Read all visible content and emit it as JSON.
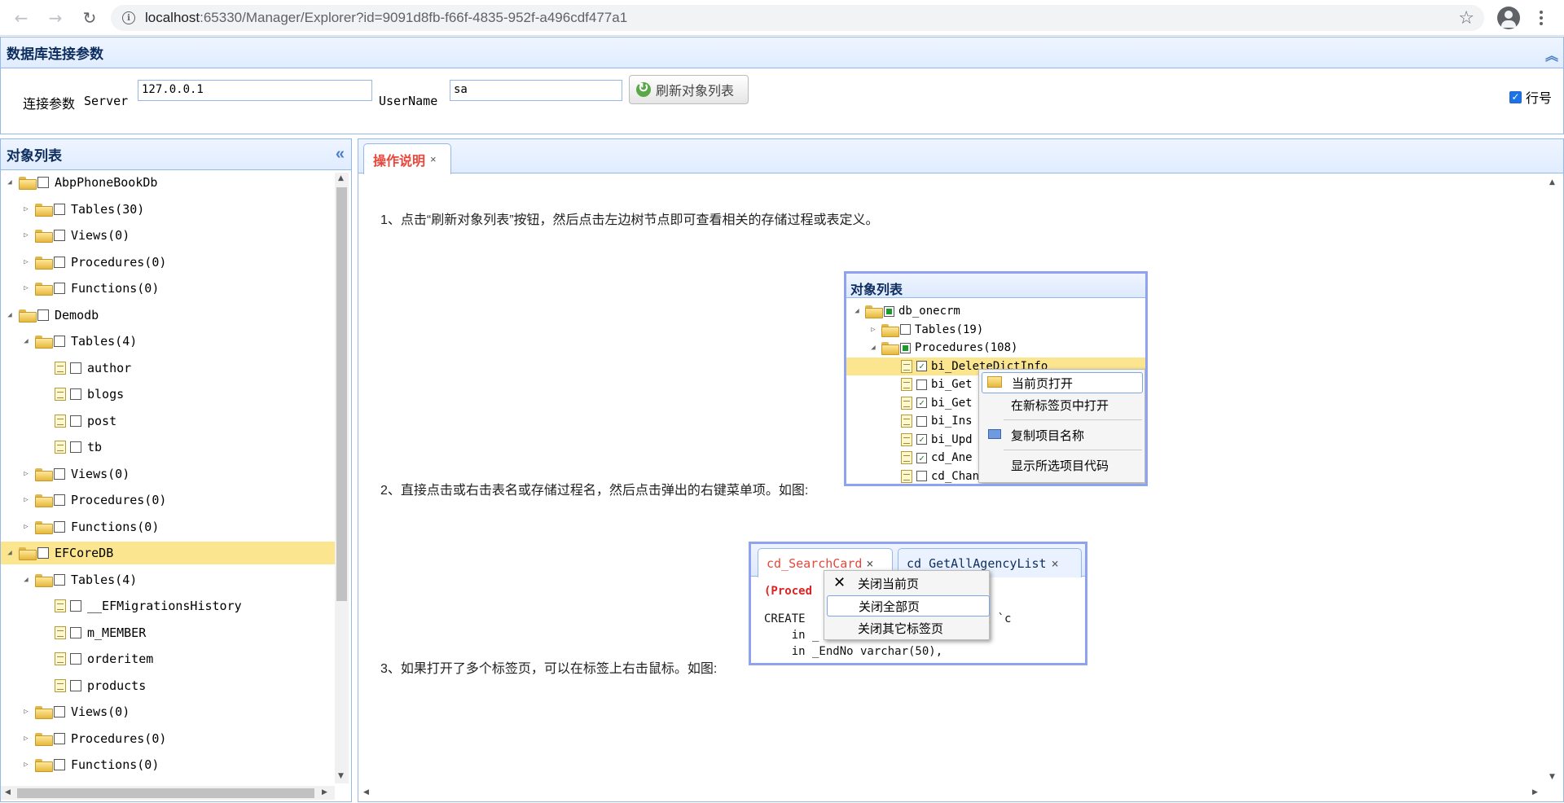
{
  "browser": {
    "url_host": "localhost",
    "url_rest": ":65330/Manager/Explorer?id=9091d8fb-f66f-4835-952f-a496cdf477a1"
  },
  "conn_panel": {
    "title": "数据库连接参数",
    "label": "连接参数",
    "server_label": "Server",
    "server_value": "127.0.0.1",
    "username_label": "UserName",
    "username_value": "sa",
    "refresh_label": "刷新对象列表",
    "linenum_label": "行号",
    "linenum_checked": true
  },
  "object_panel": {
    "title": "对象列表",
    "tree": [
      {
        "label": "AbpPhoneBookDb",
        "level": 0,
        "icon": "folder-icon",
        "toggle": "expanded"
      },
      {
        "label": "Tables(30)",
        "level": 1,
        "icon": "folder-icon",
        "toggle": "collapsed"
      },
      {
        "label": "Views(0)",
        "level": 1,
        "icon": "folder-icon",
        "toggle": "collapsed"
      },
      {
        "label": "Procedures(0)",
        "level": 1,
        "icon": "folder-icon",
        "toggle": "collapsed"
      },
      {
        "label": "Functions(0)",
        "level": 1,
        "icon": "folder-icon",
        "toggle": "collapsed"
      },
      {
        "label": "Demodb",
        "level": 0,
        "icon": "folder-icon",
        "toggle": "expanded"
      },
      {
        "label": "Tables(4)",
        "level": 1,
        "icon": "folder-icon",
        "toggle": "expanded"
      },
      {
        "label": "author",
        "level": 2,
        "icon": "file-icon",
        "toggle": ""
      },
      {
        "label": "blogs",
        "level": 2,
        "icon": "file-icon",
        "toggle": ""
      },
      {
        "label": "post",
        "level": 2,
        "icon": "file-icon",
        "toggle": ""
      },
      {
        "label": "tb",
        "level": 2,
        "icon": "file-icon",
        "toggle": ""
      },
      {
        "label": "Views(0)",
        "level": 1,
        "icon": "folder-icon",
        "toggle": "collapsed"
      },
      {
        "label": "Procedures(0)",
        "level": 1,
        "icon": "folder-icon",
        "toggle": "collapsed"
      },
      {
        "label": "Functions(0)",
        "level": 1,
        "icon": "folder-icon",
        "toggle": "collapsed"
      },
      {
        "label": "EFCoreDB",
        "level": 0,
        "icon": "folder-icon",
        "toggle": "expanded",
        "selected": true
      },
      {
        "label": "Tables(4)",
        "level": 1,
        "icon": "folder-icon",
        "toggle": "expanded"
      },
      {
        "label": "__EFMigrationsHistory",
        "level": 2,
        "icon": "file-icon",
        "toggle": ""
      },
      {
        "label": "m_MEMBER",
        "level": 2,
        "icon": "file-icon",
        "toggle": ""
      },
      {
        "label": "orderitem",
        "level": 2,
        "icon": "file-icon",
        "toggle": ""
      },
      {
        "label": "products",
        "level": 2,
        "icon": "file-icon",
        "toggle": ""
      },
      {
        "label": "Views(0)",
        "level": 1,
        "icon": "folder-icon",
        "toggle": "collapsed"
      },
      {
        "label": "Procedures(0)",
        "level": 1,
        "icon": "folder-icon",
        "toggle": "collapsed"
      },
      {
        "label": "Functions(0)",
        "level": 1,
        "icon": "folder-icon",
        "toggle": "collapsed"
      }
    ]
  },
  "main": {
    "tab_label": "操作说明",
    "tab_close": "×",
    "step1": "1、点击“刷新对象列表”按钮，然后点击左边树节点即可查看相关的存储过程或表定义。",
    "step2": "2、直接点击或右击表名或存储过程名，然后点击弹出的右键菜单项。如图:",
    "step3": "3、如果打开了多个标签页，可以在标签上右击鼠标。如图:"
  },
  "illustration1": {
    "title": "对象列表",
    "nodes": [
      {
        "label": "db_onecrm",
        "check": "partial",
        "icon": "folder-icon",
        "toggle": "expanded",
        "level": 0
      },
      {
        "label": "Tables(19)",
        "check": "none",
        "icon": "folder-icon",
        "toggle": "collapsed",
        "level": 1
      },
      {
        "label": "Procedures(108)",
        "check": "partial",
        "icon": "folder-icon",
        "toggle": "expanded",
        "level": 1
      },
      {
        "label": "bi_DeleteDictInfo",
        "check": "checked",
        "icon": "file-icon",
        "level": 2,
        "highlight": true
      },
      {
        "label": "bi_Get",
        "check": "none",
        "icon": "file-icon",
        "level": 2
      },
      {
        "label": "bi_Get",
        "check": "checked",
        "icon": "file-icon",
        "level": 2
      },
      {
        "label": "bi_Ins",
        "check": "none",
        "icon": "file-icon",
        "level": 2
      },
      {
        "label": "bi_Upd",
        "check": "checked",
        "icon": "file-icon",
        "level": 2
      },
      {
        "label": "cd_Ane",
        "check": "checked",
        "icon": "file-icon",
        "level": 2
      },
      {
        "label": "cd_ChangeStatus",
        "check": "none",
        "icon": "file-icon",
        "level": 2
      }
    ],
    "menu": [
      {
        "label": "当前页打开",
        "icon": "open-folder-icon"
      },
      {
        "label": "在新标签页中打开",
        "icon": ""
      },
      {
        "label": "复制项目名称",
        "icon": "copy-icon"
      },
      {
        "label": "显示所选项目代码",
        "icon": ""
      }
    ]
  },
  "illustration2": {
    "tabs": [
      {
        "label": "cd_SearchCard",
        "active": true
      },
      {
        "label": "cd_GetAllAgencyList",
        "active": false
      }
    ],
    "code_prefix": "(Proced",
    "code_lines": [
      "CREATE                  PROCEDURE `c",
      "    in _",
      "    in _EndNo varchar(50),"
    ],
    "menu": [
      {
        "label": "关闭当前页",
        "icon": "close-x-icon"
      },
      {
        "label": "关闭全部页",
        "icon": ""
      },
      {
        "label": "关闭其它标签页",
        "icon": ""
      }
    ]
  }
}
